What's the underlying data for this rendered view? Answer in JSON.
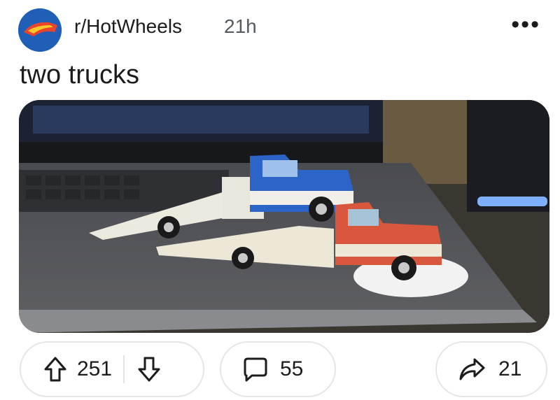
{
  "post": {
    "subreddit": "r/HotWheels",
    "age": "21h",
    "more_label": "•••",
    "title": "two trucks",
    "image_alt": "Two toy trucks on a laptop"
  },
  "actions": {
    "upvotes": "251",
    "comments": "55",
    "shares": "21"
  },
  "colors": {
    "accent_blue": "#1f5fb8",
    "border": "#e3e6e8"
  }
}
